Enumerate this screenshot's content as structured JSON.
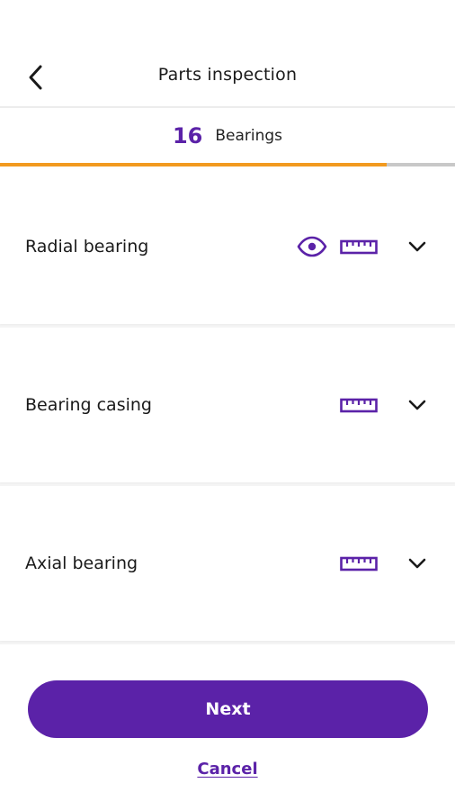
{
  "header": {
    "title": "Parts inspection",
    "back_icon": "chevron-left-icon"
  },
  "counter": {
    "value": "16",
    "label": "Bearings"
  },
  "progress": {
    "fraction": 0.85,
    "fill_color": "#f29a1f",
    "track_color": "#c8c8c8"
  },
  "items": [
    {
      "label": "Radial bearing",
      "icons": [
        "eye-icon",
        "ruler-icon",
        "chevron-down-icon"
      ]
    },
    {
      "label": "Bearing casing",
      "icons": [
        "ruler-icon",
        "chevron-down-icon"
      ]
    },
    {
      "label": "Axial bearing",
      "icons": [
        "ruler-icon",
        "chevron-down-icon"
      ]
    }
  ],
  "actions": {
    "next_label": "Next",
    "cancel_label": "Cancel"
  },
  "colors": {
    "accent": "#5b22a8",
    "progress": "#f29a1f"
  }
}
